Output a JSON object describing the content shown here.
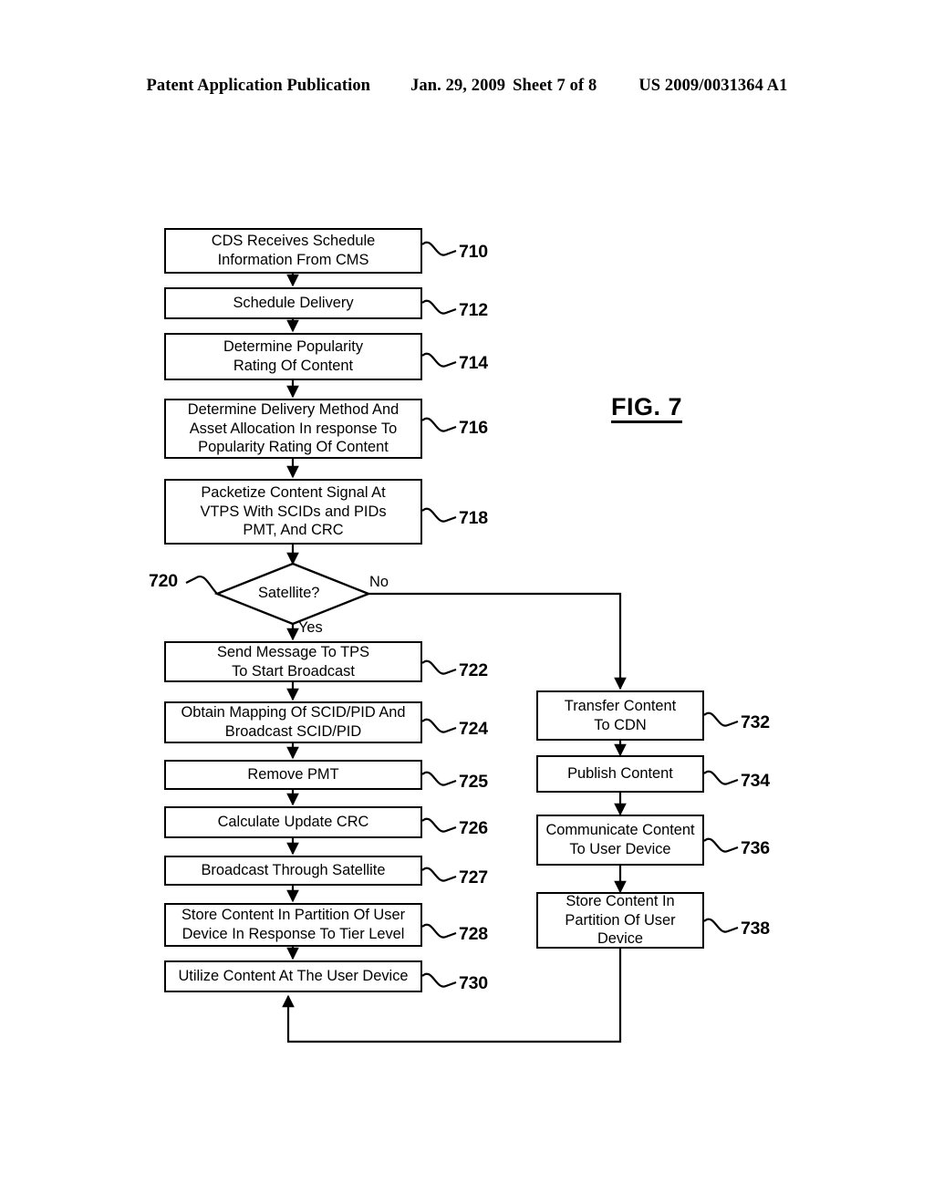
{
  "header": {
    "publication": "Patent Application Publication",
    "date": "Jan. 29, 2009",
    "sheet": "Sheet 7 of 8",
    "patent_number": "US 2009/0031364 A1"
  },
  "figure": {
    "label": "FIG. 7"
  },
  "flowchart": {
    "nodes": [
      {
        "ref": "710",
        "text": "CDS Receives Schedule\nInformation From CMS"
      },
      {
        "ref": "712",
        "text": "Schedule Delivery"
      },
      {
        "ref": "714",
        "text": "Determine Popularity\nRating Of Content"
      },
      {
        "ref": "716",
        "text": "Determine Delivery Method And\nAsset Allocation In response To\nPopularity Rating Of Content"
      },
      {
        "ref": "718",
        "text": "Packetize Content Signal At\nVTPS With SCIDs and PIDs\nPMT, And CRC"
      },
      {
        "ref": "720",
        "text": "Satellite?"
      },
      {
        "ref": "722",
        "text": "Send Message To TPS\nTo Start Broadcast"
      },
      {
        "ref": "724",
        "text": "Obtain Mapping Of SCID/PID And\nBroadcast SCID/PID"
      },
      {
        "ref": "725",
        "text": "Remove PMT"
      },
      {
        "ref": "726",
        "text": "Calculate Update CRC"
      },
      {
        "ref": "727",
        "text": "Broadcast Through Satellite"
      },
      {
        "ref": "728",
        "text": "Store Content In Partition Of User\nDevice In Response To Tier Level"
      },
      {
        "ref": "730",
        "text": "Utilize Content At The User Device"
      },
      {
        "ref": "732",
        "text": "Transfer Content\nTo CDN"
      },
      {
        "ref": "734",
        "text": "Publish Content"
      },
      {
        "ref": "736",
        "text": "Communicate Content\nTo User Device"
      },
      {
        "ref": "738",
        "text": "Store Content In\nPartition Of User\nDevice"
      }
    ],
    "branch_labels": {
      "yes": "Yes",
      "no": "No"
    }
  }
}
